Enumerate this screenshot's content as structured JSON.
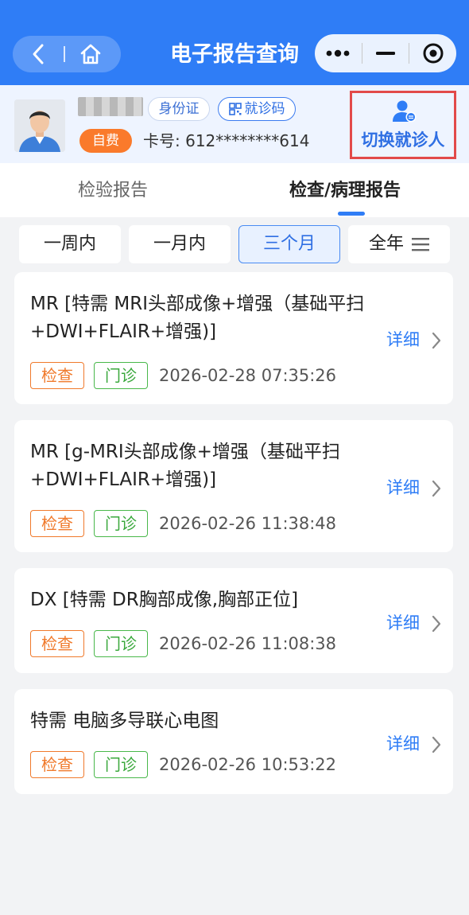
{
  "header": {
    "title": "电子报告查询"
  },
  "patient": {
    "id_label": "身份证",
    "visit_code_label": "就诊码",
    "self_pay": "自费",
    "card_no": "卡号: 612********614",
    "switch_label": "切换就诊人"
  },
  "tabs": [
    {
      "label": "检验报告"
    },
    {
      "label": "检查/病理报告"
    }
  ],
  "filters": [
    {
      "label": "一周内"
    },
    {
      "label": "一月内"
    },
    {
      "label": "三个月"
    },
    {
      "label": "全年"
    }
  ],
  "reports": [
    {
      "title_line1": "MR [特需 MRI头部成像+增强（基础平扫",
      "title_line2": "+DWI+FLAIR+增强)]",
      "tag1": "检查",
      "tag2": "门诊",
      "time": "2026-02-28 07:35:26",
      "detail": "详细"
    },
    {
      "title_line1": "MR [g-MRI头部成像+增强（基础平扫",
      "title_line2": "+DWI+FLAIR+增强)]",
      "tag1": "检查",
      "tag2": "门诊",
      "time": "2026-02-26 11:38:48",
      "detail": "详细"
    },
    {
      "title_line1": "DX [特需 DR胸部成像,胸部正位]",
      "tag1": "检查",
      "tag2": "门诊",
      "time": "2026-02-26 11:08:38",
      "detail": "详细"
    },
    {
      "title_line1": "特需  电脑多导联心电图",
      "tag1": "检查",
      "tag2": "门诊",
      "time": "2026-02-26 10:53:22",
      "detail": "详细"
    }
  ],
  "colors": {
    "primary": "#2f7df6",
    "tag_exam": "#f07a2c",
    "tag_outpatient": "#49b84a",
    "highlight_border": "#e24a4a"
  }
}
